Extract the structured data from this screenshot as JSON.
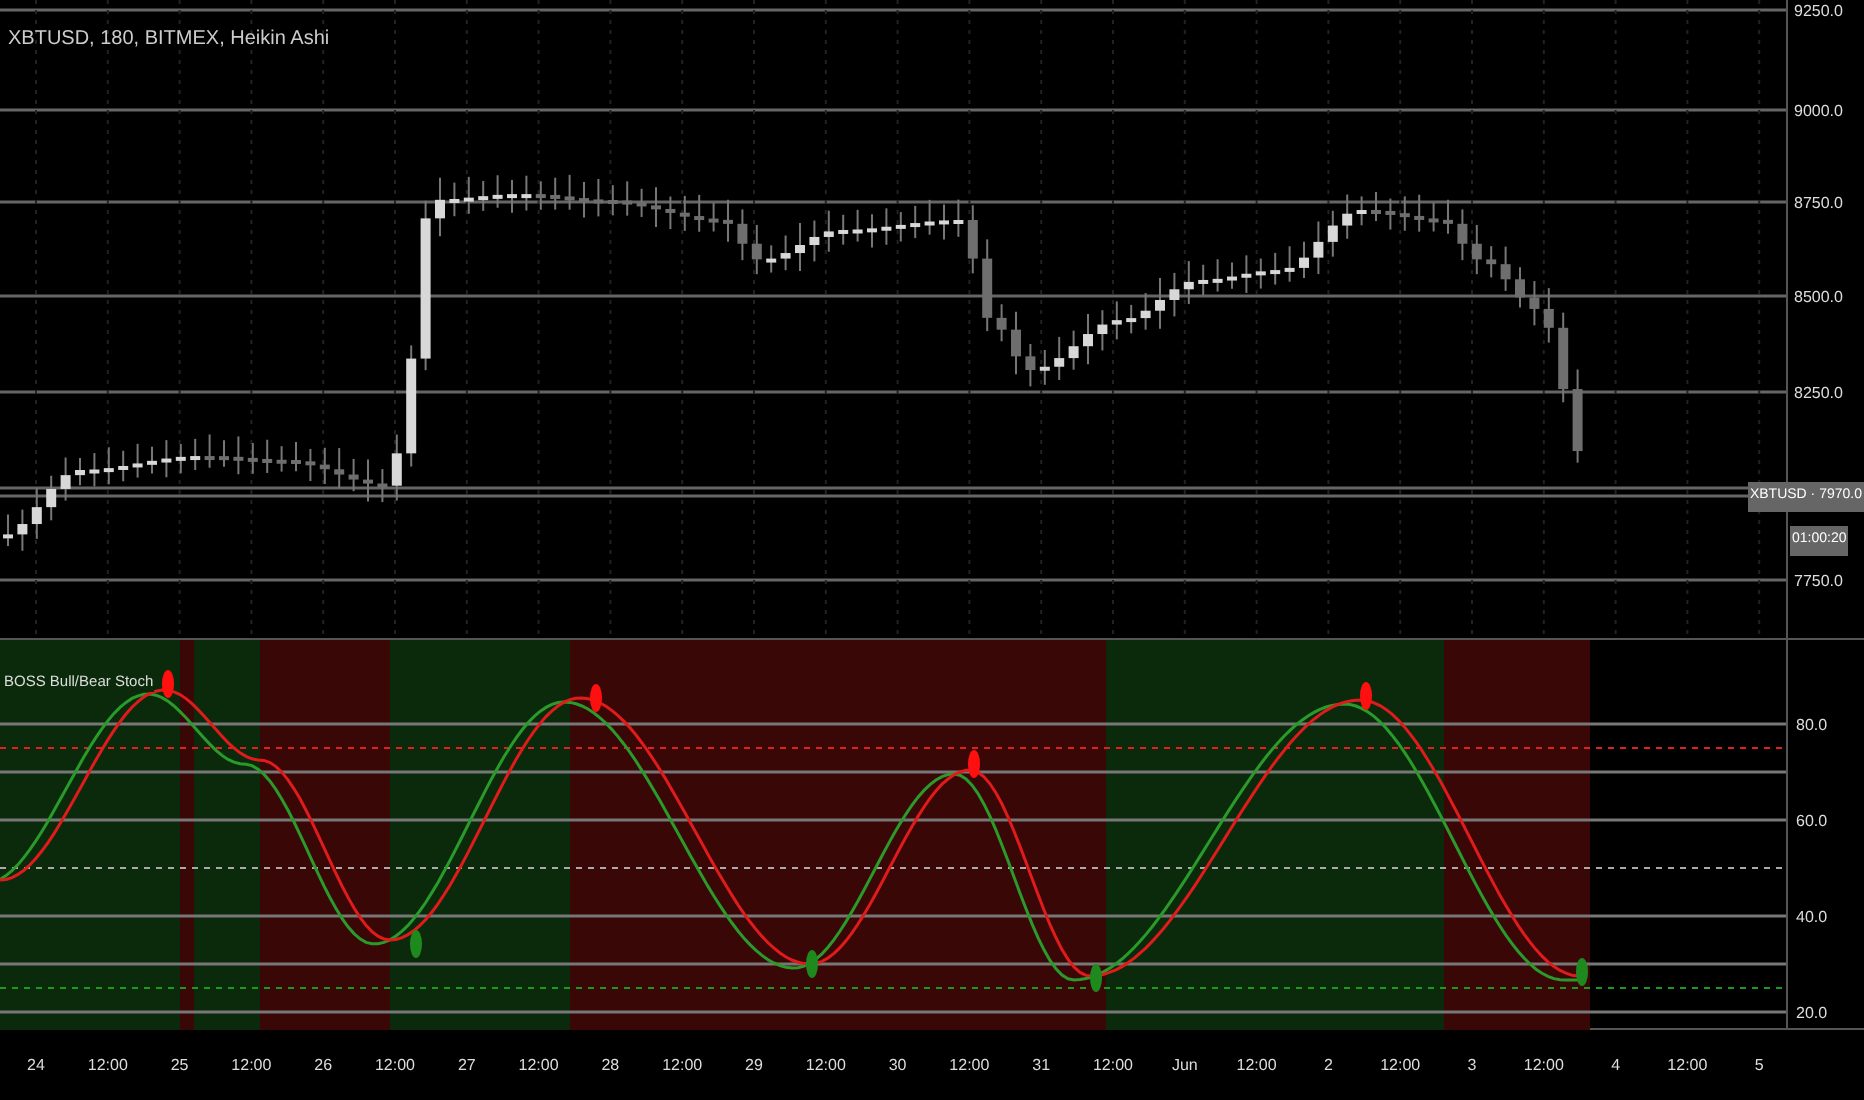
{
  "chart": {
    "title": "XBTUSD, 180, BITMEX, Heikin Ashi",
    "price_labels": [
      "9250.0",
      "9000.0",
      "8750.0",
      "8500.0",
      "8250.0",
      "7750.0"
    ],
    "last_price_tag": "XBTUSD · 7970.0",
    "countdown_tag": "01:00:20"
  },
  "indicator": {
    "title": "BOSS Bull/Bear Stoch",
    "labels": [
      "80.0",
      "60.0",
      "40.0",
      "20.0"
    ]
  },
  "time_axis": [
    "24",
    "12:00",
    "25",
    "12:00",
    "26",
    "12:00",
    "27",
    "12:00",
    "28",
    "12:00",
    "29",
    "12:00",
    "30",
    "12:00",
    "31",
    "12:00",
    "Jun",
    "12:00",
    "2",
    "12:00",
    "3",
    "12:00",
    "4",
    "12:00",
    "5"
  ]
}
